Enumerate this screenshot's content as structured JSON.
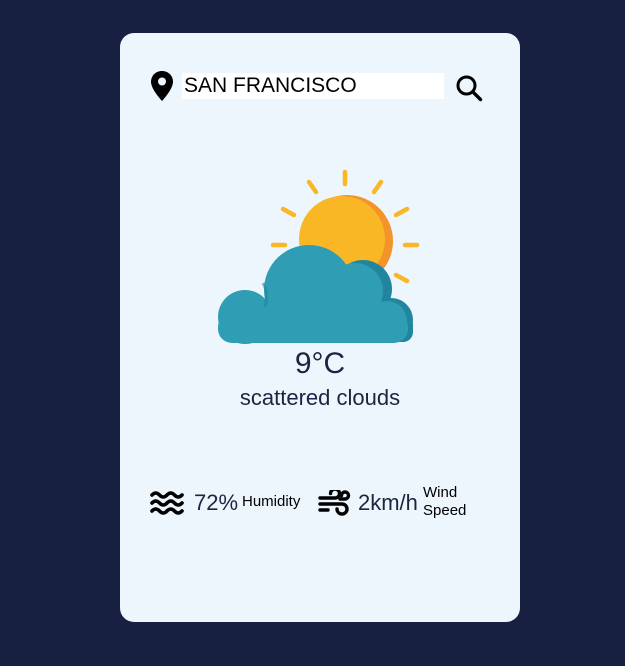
{
  "search": {
    "value": "SAN FRANCISCO",
    "location_icon": "map-pin-icon",
    "search_icon": "magnifier-icon"
  },
  "weather": {
    "icon": "sun-behind-cloud-icon",
    "temperature": "9°C",
    "description": "scattered clouds"
  },
  "stats": {
    "humidity": {
      "icon": "waves-icon",
      "value": "72%",
      "label": "Humidity"
    },
    "wind": {
      "icon": "wind-icon",
      "value": "2km/h",
      "label_line1": "Wind",
      "label_line2": "Speed"
    }
  },
  "colors": {
    "background": "#182041",
    "card": "#edf6fd",
    "text": "#1b2440",
    "sun": "#f9b625",
    "sun_shade": "#f3932a",
    "cloud": "#2f9db4",
    "cloud_shade": "#2285a0"
  }
}
